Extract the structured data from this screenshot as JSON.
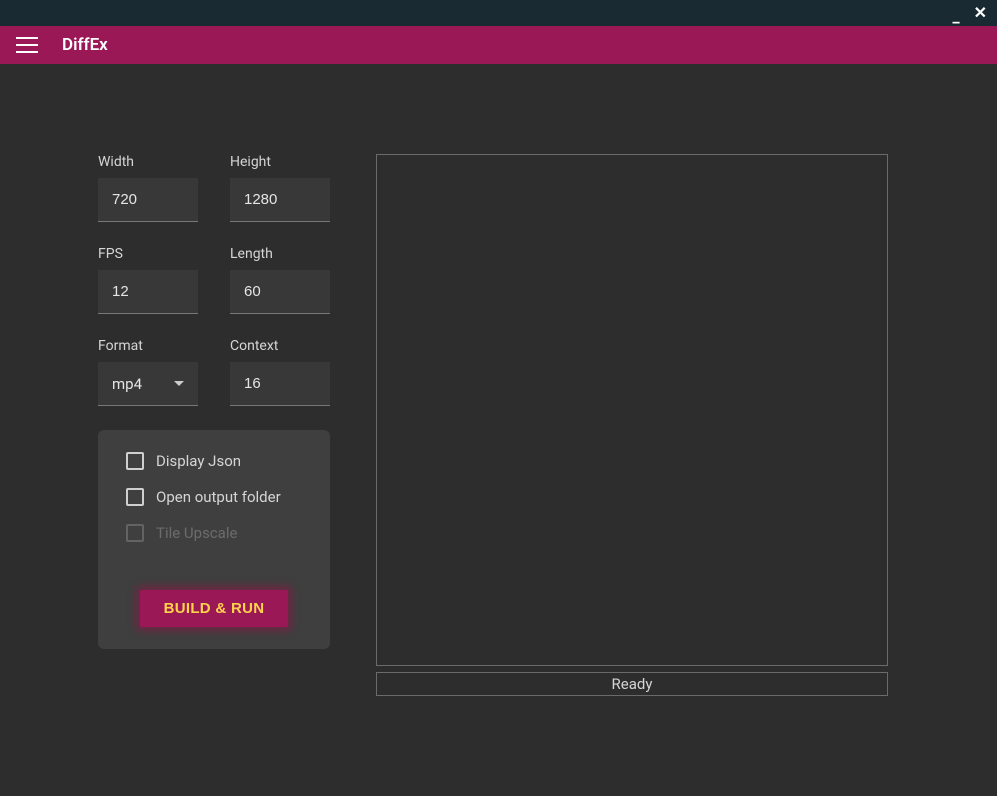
{
  "app": {
    "title": "DiffEx"
  },
  "fields": {
    "width": {
      "label": "Width",
      "value": "720"
    },
    "height": {
      "label": "Height",
      "value": "1280"
    },
    "fps": {
      "label": "FPS",
      "value": "12"
    },
    "length": {
      "label": "Length",
      "value": "60"
    },
    "format": {
      "label": "Format",
      "value": "mp4"
    },
    "context": {
      "label": "Context",
      "value": "16"
    }
  },
  "options": {
    "display_json": {
      "label": "Display Json",
      "checked": false,
      "enabled": true
    },
    "open_output": {
      "label": "Open output folder",
      "checked": false,
      "enabled": true
    },
    "tile_upscale": {
      "label": "Tile Upscale",
      "checked": false,
      "enabled": false
    }
  },
  "actions": {
    "build_run": "BUILD & RUN"
  },
  "status": "Ready"
}
